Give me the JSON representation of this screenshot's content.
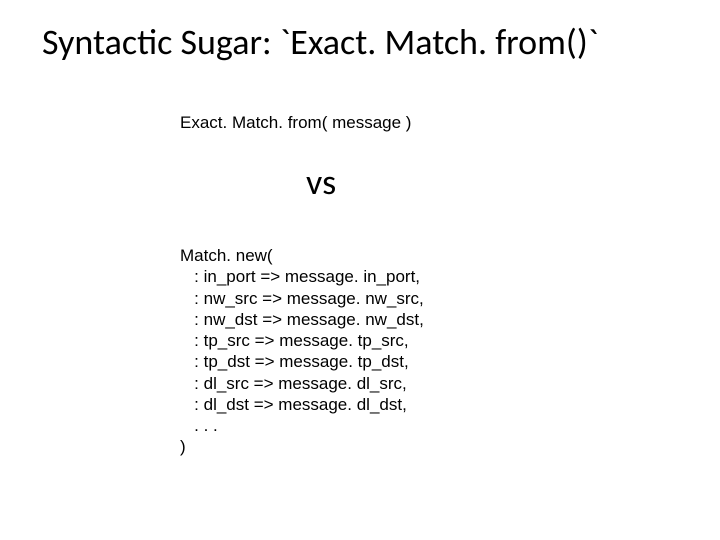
{
  "title": "Syntactic Sugar: `Exact. Match. from()`",
  "short_call": "Exact. Match. from( message )",
  "vs": "vs",
  "long_call": "Match. new(\n   : in_port => message. in_port,\n   : nw_src => message. nw_src,\n   : nw_dst => message. nw_dst,\n   : tp_src => message. tp_src,\n   : tp_dst => message. tp_dst,\n   : dl_src => message. dl_src,\n   : dl_dst => message. dl_dst,\n   . . .\n)"
}
